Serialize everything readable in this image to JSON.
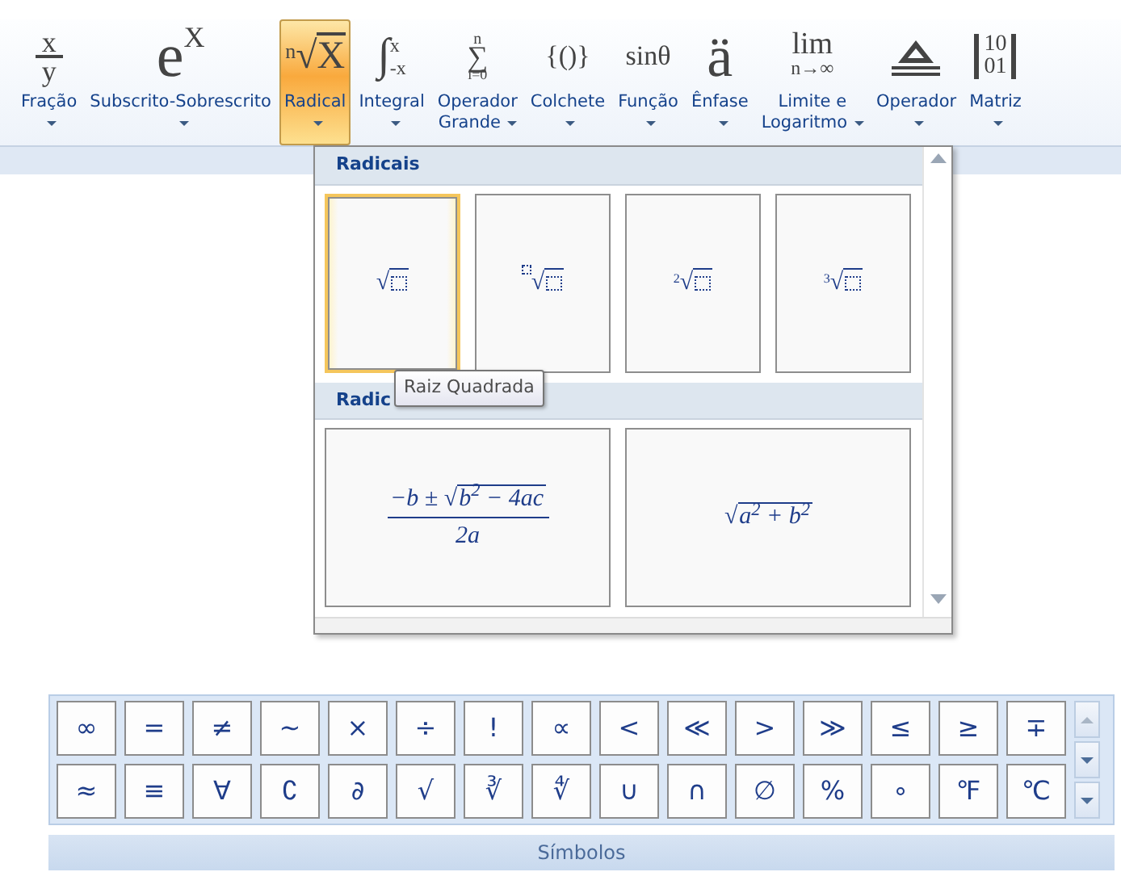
{
  "ribbon": {
    "items": [
      {
        "kind": "fraction",
        "num": "x",
        "den": "y",
        "label": [
          "Fração"
        ],
        "selected": false
      },
      {
        "kind": "script",
        "base": "e",
        "sup": "X",
        "label": [
          "Subscrito-Sobrescrito"
        ],
        "selected": false
      },
      {
        "kind": "radical",
        "index": "n",
        "symbol": "√",
        "base": "X",
        "label": [
          "Radical"
        ],
        "selected": true
      },
      {
        "kind": "integral",
        "symbol": "∫",
        "sup": "x",
        "sub": "-x",
        "label": [
          "Integral"
        ],
        "selected": false
      },
      {
        "kind": "sum",
        "symbol": "∑",
        "sup": "n",
        "sub": "i=0",
        "label": [
          "Operador",
          "Grande"
        ],
        "selected": false
      },
      {
        "kind": "text",
        "text": "{()}",
        "label": [
          "Colchete"
        ],
        "selected": false
      },
      {
        "kind": "text",
        "text": "sinθ",
        "label": [
          "Função"
        ],
        "selected": false
      },
      {
        "kind": "big",
        "text": "ä",
        "label": [
          "Ênfase"
        ],
        "selected": false
      },
      {
        "kind": "limit",
        "top": "lim",
        "bottom": "n→∞",
        "label": [
          "Limite e",
          "Logaritmo"
        ],
        "selected": false
      },
      {
        "kind": "operator",
        "label": [
          "Operador"
        ],
        "selected": false
      },
      {
        "kind": "matrix",
        "rows": [
          "10",
          "01"
        ],
        "label": [
          "Matriz"
        ],
        "selected": false
      }
    ]
  },
  "gallery": {
    "sections": [
      {
        "header": "Radicais",
        "tiles": [
          {
            "kind": "root",
            "radical": "√",
            "hovered": true
          },
          {
            "kind": "root_placeholder",
            "radical": "√",
            "hovered": false
          },
          {
            "kind": "root_index",
            "index": "2",
            "radical": "√",
            "hovered": false
          },
          {
            "kind": "root_index",
            "index": "3",
            "radical": "√",
            "hovered": false
          }
        ]
      },
      {
        "header": "Radic",
        "tiles": [
          {
            "kind": "fraction",
            "num_pre": "−b ± ",
            "radical": "√",
            "num_root": "b$^{2}$ − 4ac",
            "den": "2a",
            "hovered": false
          },
          {
            "kind": "sqrt",
            "radical": "√",
            "body": "a$^{2}$ + b$^{2}$",
            "hovered": false
          }
        ]
      }
    ],
    "tooltip": "Raiz Quadrada"
  },
  "symbols": {
    "items": [
      "∞",
      "=",
      "≠",
      "~",
      "×",
      "÷",
      "!",
      "∝",
      "<",
      "≪",
      ">",
      "≫",
      "≤",
      "≥",
      "∓",
      "≈",
      "≡",
      "∀",
      "∁",
      "∂",
      "√",
      "∛",
      "∜",
      "∪",
      "∩",
      "∅",
      "%",
      "∘",
      "℉",
      "℃"
    ],
    "group_label": "Símbolos"
  }
}
